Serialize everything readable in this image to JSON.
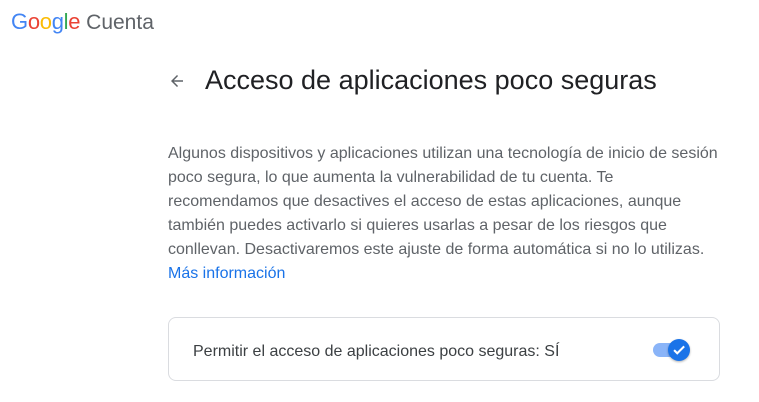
{
  "header": {
    "logo_letters": [
      "G",
      "o",
      "o",
      "g",
      "l",
      "e"
    ],
    "product_name": "Cuenta"
  },
  "main": {
    "title": "Acceso de aplicaciones poco seguras",
    "description": "Algunos dispositivos y aplicaciones utilizan una tecnología de inicio de sesión poco segura, lo que aumenta la vulnerabilidad de tu cuenta. Te recomendamos que desactives el acceso de estas aplicaciones, aunque también puedes activarlo si quieres usarlas a pesar de los riesgos que conllevan. Desactivaremos este ajuste de forma automática si no lo utilizas.",
    "learn_more_label": "Más información"
  },
  "setting": {
    "label": "Permitir el acceso de aplicaciones poco seguras: SÍ",
    "toggle_on": true
  },
  "icons": {
    "back": "arrow-back-icon",
    "check": "check-icon"
  },
  "colors": {
    "google_blue": "#4285f4",
    "google_red": "#ea4335",
    "google_yellow": "#fbbc05",
    "google_green": "#34a853",
    "link_blue": "#1a73e8",
    "toggle_track": "#8ab4f8",
    "toggle_thumb": "#1a73e8"
  }
}
